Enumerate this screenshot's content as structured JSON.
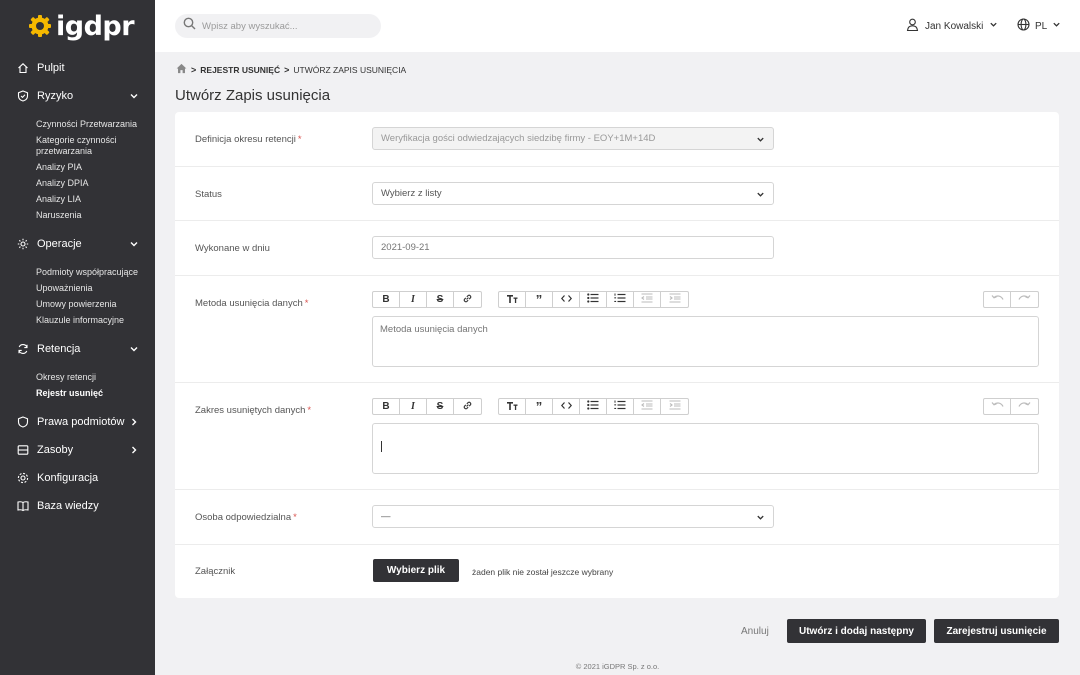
{
  "brand": {
    "name": "igdpr",
    "accent": "#f5b800"
  },
  "sidebar": {
    "items": [
      {
        "label": "Pulpit",
        "icon": "home-icon"
      },
      {
        "label": "Ryzyko",
        "icon": "shield-check-icon",
        "expanded": true,
        "children": [
          "Czynności Przetwarzania",
          "Kategorie czynności przetwarzania",
          "Analizy PIA",
          "Analizy DPIA",
          "Analizy LIA",
          "Naruszenia"
        ]
      },
      {
        "label": "Operacje",
        "icon": "gear-icon",
        "expanded": true,
        "children": [
          "Podmioty współpracujące",
          "Upoważnienia",
          "Umowy powierzenia",
          "Klauzule informacyjne"
        ]
      },
      {
        "label": "Retencja",
        "icon": "refresh-icon",
        "expanded": true,
        "children": [
          "Okresy retencji",
          "Rejestr usunięć"
        ],
        "active_child": "Rejestr usunięć"
      },
      {
        "label": "Prawa podmiotów",
        "icon": "shield-icon"
      },
      {
        "label": "Zasoby",
        "icon": "database-icon"
      },
      {
        "label": "Konfiguracja",
        "icon": "cog-icon"
      },
      {
        "label": "Baza wiedzy",
        "icon": "book-icon"
      }
    ]
  },
  "header": {
    "search_placeholder": "Wpisz aby wyszukać...",
    "user_name": "Jan Kowalski",
    "language": "PL"
  },
  "breadcrumb": [
    "REJESTR USUNIĘĆ",
    "UTWÓRZ ZAPIS USUNIĘCIA"
  ],
  "page_title": "Utwórz Zapis usunięcia",
  "form": {
    "retention_label": "Definicja okresu retencji",
    "retention_value": "Weryfikacja gości odwiedzających siedzibę firmy - EOY+1M+14D",
    "status_label": "Status",
    "status_value": "Wybierz z listy",
    "date_label": "Wykonane w dniu",
    "date_placeholder": "2021-09-21",
    "method_label": "Metoda usunięcia danych",
    "method_placeholder": "Metoda usunięcia danych",
    "scope_label": "Zakres usuniętych danych",
    "scope_placeholder": "",
    "person_label": "Osoba odpowiedzialna",
    "person_value": "—",
    "attachment_label": "Załącznik",
    "file_button": "Wybierz plik",
    "file_note": "żaden plik nie został jeszcze wybrany",
    "required_mark": "*"
  },
  "actions": {
    "cancel": "Anuluj",
    "create_and_next": "Utwórz i dodaj następny",
    "register": "Zarejestruj usunięcie"
  },
  "footer": "© 2021 iGDPR Sp. z o.o."
}
